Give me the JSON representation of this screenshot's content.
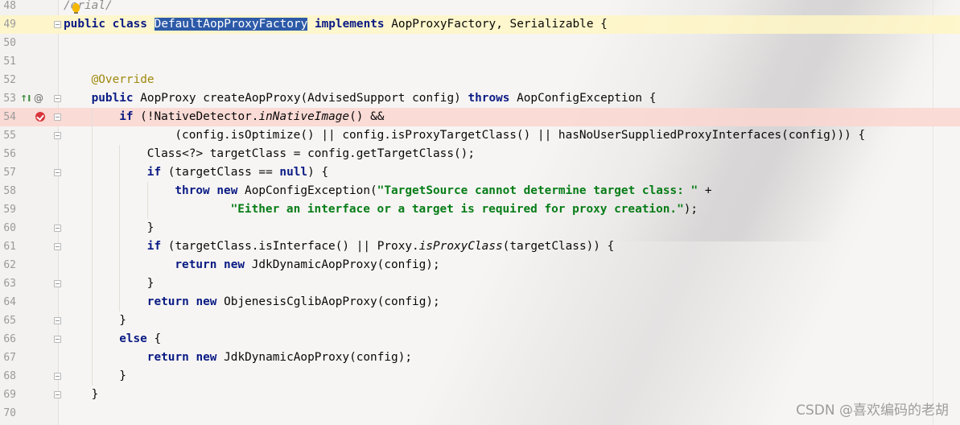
{
  "editor": {
    "lines": [
      {
        "n": "48",
        "ind": 0,
        "tokens": [
          [
            "cmt",
            "/"
          ],
          [
            "cmt",
            "erial/"
          ]
        ]
      },
      {
        "n": "49",
        "ind": 0,
        "tokens": [
          [
            "kw",
            "public"
          ],
          [
            "p",
            " "
          ],
          [
            "kw",
            "class"
          ],
          [
            "p",
            " "
          ],
          [
            "sel",
            "DefaultAopProxyFactory"
          ],
          [
            "p",
            " "
          ],
          [
            "kw",
            "implements"
          ],
          [
            "p",
            " AopProxyFactory, Serializable {"
          ]
        ]
      },
      {
        "n": "50",
        "ind": 0,
        "tokens": []
      },
      {
        "n": "51",
        "ind": 0,
        "tokens": []
      },
      {
        "n": "52",
        "ind": 4,
        "tokens": [
          [
            "ann",
            "@Override"
          ]
        ]
      },
      {
        "n": "53",
        "ind": 4,
        "tokens": [
          [
            "kw",
            "public"
          ],
          [
            "p",
            " AopProxy createAopProxy(AdvisedSupport config) "
          ],
          [
            "kw",
            "throws"
          ],
          [
            "p",
            " AopConfigException {"
          ]
        ]
      },
      {
        "n": "54",
        "ind": 8,
        "tokens": [
          [
            "kw",
            "if"
          ],
          [
            "p",
            " (!NativeDetector."
          ],
          [
            "it",
            "inNativeImage"
          ],
          [
            "p",
            "() &&"
          ]
        ]
      },
      {
        "n": "55",
        "ind": 16,
        "tokens": [
          [
            "p",
            "(config.isOptimize() || config.isProxyTargetClass() || hasNoUserSuppliedProxyInterfaces(config))) {"
          ]
        ]
      },
      {
        "n": "56",
        "ind": 12,
        "tokens": [
          [
            "p",
            "Class<?> targetClass = config.getTargetClass();"
          ]
        ]
      },
      {
        "n": "57",
        "ind": 12,
        "tokens": [
          [
            "kw",
            "if"
          ],
          [
            "p",
            " (targetClass == "
          ],
          [
            "kw",
            "null"
          ],
          [
            "p",
            ") {"
          ]
        ]
      },
      {
        "n": "58",
        "ind": 16,
        "tokens": [
          [
            "kw",
            "throw"
          ],
          [
            "p",
            " "
          ],
          [
            "kw",
            "new"
          ],
          [
            "p",
            " AopConfigException("
          ],
          [
            "str",
            "\"TargetSource cannot determine target class: \""
          ],
          [
            "p",
            " +"
          ]
        ]
      },
      {
        "n": "59",
        "ind": 24,
        "tokens": [
          [
            "str",
            "\"Either an interface or a target is required for proxy creation.\""
          ],
          [
            "p",
            ");"
          ]
        ]
      },
      {
        "n": "60",
        "ind": 12,
        "tokens": [
          [
            "p",
            "}"
          ]
        ]
      },
      {
        "n": "61",
        "ind": 12,
        "tokens": [
          [
            "kw",
            "if"
          ],
          [
            "p",
            " (targetClass.isInterface() || Proxy."
          ],
          [
            "it",
            "isProxyClass"
          ],
          [
            "p",
            "(targetClass)) {"
          ]
        ]
      },
      {
        "n": "62",
        "ind": 16,
        "tokens": [
          [
            "kw",
            "return"
          ],
          [
            "p",
            " "
          ],
          [
            "kw",
            "new"
          ],
          [
            "p",
            " JdkDynamicAopProxy(config);"
          ]
        ]
      },
      {
        "n": "63",
        "ind": 12,
        "tokens": [
          [
            "p",
            "}"
          ]
        ]
      },
      {
        "n": "64",
        "ind": 12,
        "tokens": [
          [
            "kw",
            "return"
          ],
          [
            "p",
            " "
          ],
          [
            "kw",
            "new"
          ],
          [
            "p",
            " ObjenesisCglibAopProxy(config);"
          ]
        ]
      },
      {
        "n": "65",
        "ind": 8,
        "tokens": [
          [
            "p",
            "}"
          ]
        ]
      },
      {
        "n": "66",
        "ind": 8,
        "tokens": [
          [
            "kw",
            "else"
          ],
          [
            "p",
            " {"
          ]
        ]
      },
      {
        "n": "67",
        "ind": 12,
        "tokens": [
          [
            "kw",
            "return"
          ],
          [
            "p",
            " "
          ],
          [
            "kw",
            "new"
          ],
          [
            "p",
            " JdkDynamicAopProxy(config);"
          ]
        ]
      },
      {
        "n": "68",
        "ind": 8,
        "tokens": [
          [
            "p",
            "}"
          ]
        ]
      },
      {
        "n": "69",
        "ind": 4,
        "tokens": [
          [
            "p",
            "}"
          ]
        ]
      },
      {
        "n": "70",
        "ind": 0,
        "tokens": []
      }
    ]
  },
  "watermark": "CSDN @喜欢编码的老胡",
  "colors": {
    "keyword": "#0a1b84",
    "string": "#067d17",
    "annotation": "#9e880d",
    "selection": "#2d5aa8",
    "caret_row": "#fff6c4",
    "breakpoint_row": "#fad6d0"
  }
}
